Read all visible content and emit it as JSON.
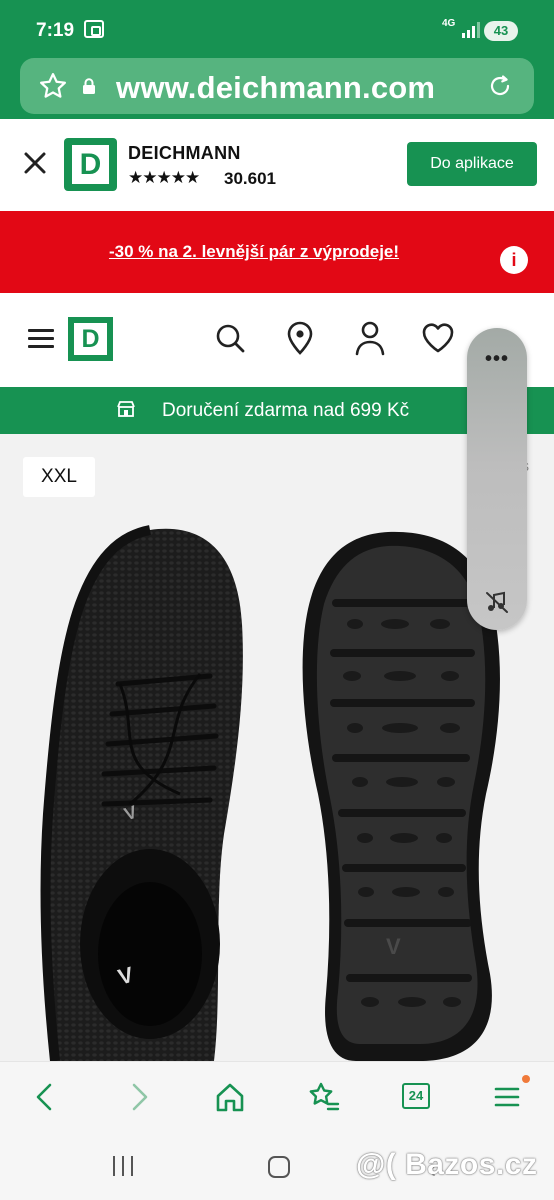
{
  "status_bar": {
    "time": "7:19",
    "network": "4G",
    "battery": "43"
  },
  "browser": {
    "url": "www.deichmann.com"
  },
  "app_banner": {
    "logo_letter": "D",
    "app_name": "DEICHMANN",
    "stars": "★★★★★",
    "rating_count": "30.601",
    "open_button": "Do aplikace"
  },
  "promo": {
    "text": "-30 % na 2. levnější pár z výprodeje!"
  },
  "header": {
    "logo_letter": "D"
  },
  "shipping": {
    "text": "Doručení zdarma nad 699 Kč"
  },
  "product": {
    "size_badge": "XXL",
    "edge_char": "S"
  },
  "toolbar": {
    "tabs_count": "24"
  },
  "watermark": "@( Bazos.cz",
  "colors": {
    "brand_green": "#179252",
    "promo_red": "#e20815"
  }
}
